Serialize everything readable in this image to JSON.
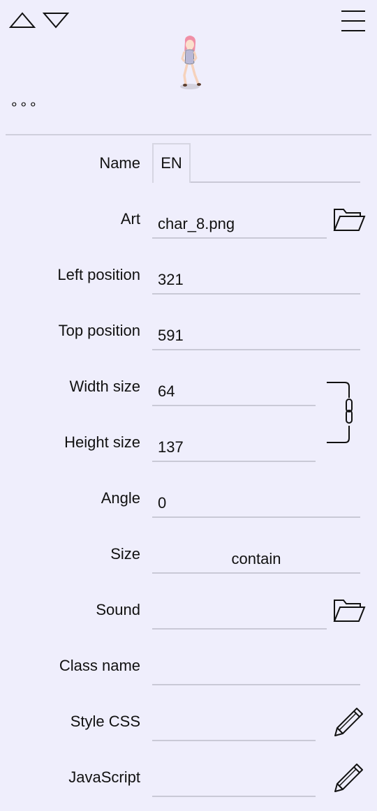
{
  "toolbar": {
    "up_icon": "triangle-up-icon",
    "down_icon": "triangle-down-icon",
    "menu_icon": "hamburger-menu-icon",
    "more_label": "∘∘∘"
  },
  "preview": {
    "sprite_icon": "character-sprite"
  },
  "form": {
    "name": {
      "label": "Name",
      "lang": "EN",
      "value": ""
    },
    "art": {
      "label": "Art",
      "value": "char_8.png",
      "icon": "folder-icon"
    },
    "left": {
      "label": "Left position",
      "value": "321"
    },
    "top": {
      "label": "Top position",
      "value": "591"
    },
    "width": {
      "label": "Width size",
      "value": "64"
    },
    "height": {
      "label": "Height size",
      "value": "137",
      "link_icon": "chain-link-icon"
    },
    "angle": {
      "label": "Angle",
      "value": "0"
    },
    "size": {
      "label": "Size",
      "value": "contain"
    },
    "sound": {
      "label": "Sound",
      "value": "",
      "icon": "folder-icon"
    },
    "classname": {
      "label": "Class name",
      "value": ""
    },
    "stylecss": {
      "label": "Style CSS",
      "value": "",
      "icon": "pencil-icon"
    },
    "javascript": {
      "label": "JavaScript",
      "value": "",
      "icon": "pencil-icon"
    }
  },
  "colors": {
    "background": "#efeefc",
    "divider": "#c9c9d6",
    "text": "#111111"
  }
}
